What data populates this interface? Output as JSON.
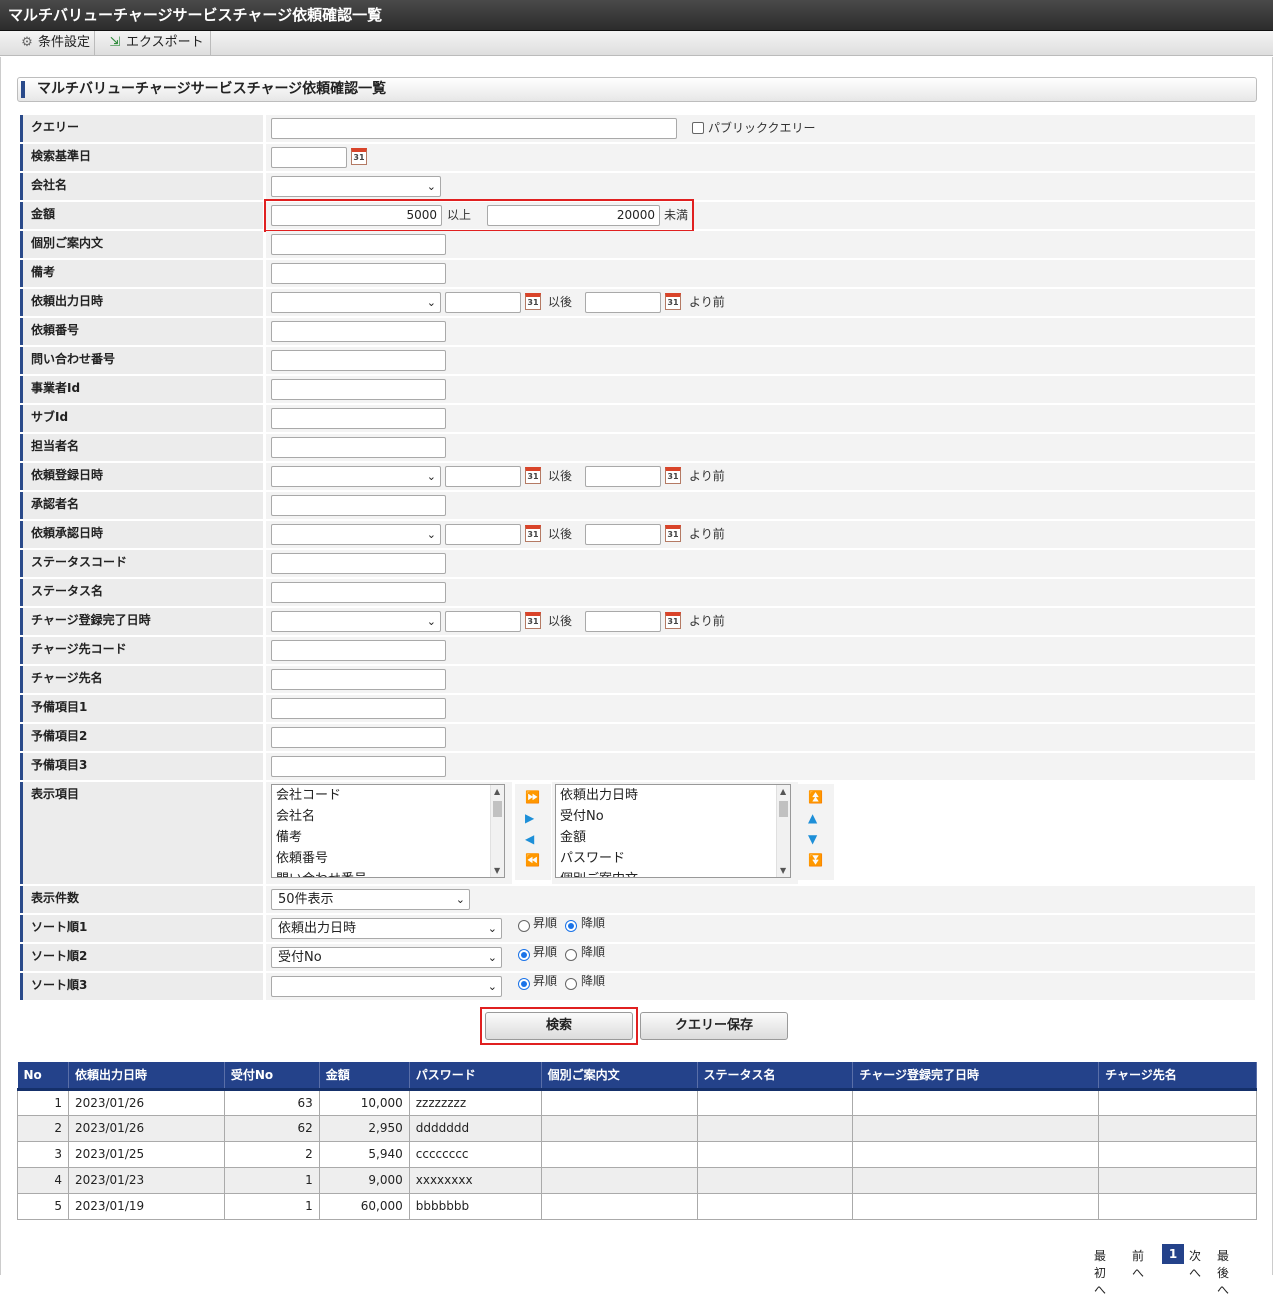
{
  "window": {
    "title": "マルチバリューチャージサービスチャージ依頼確認一覧"
  },
  "toolbar": {
    "conditions_label": "条件設定",
    "export_label": "エクスポート"
  },
  "section": {
    "title": "マルチバリューチャージサービスチャージ依頼確認一覧"
  },
  "form": {
    "query": {
      "label": "クエリー",
      "value": "",
      "public_label": "パブリッククエリー"
    },
    "base_date": {
      "label": "検索基準日",
      "value": ""
    },
    "company": {
      "label": "会社名",
      "value": ""
    },
    "amount": {
      "label": "金額",
      "min": "5000",
      "min_suffix": "以上",
      "max": "20000",
      "max_suffix": "未満"
    },
    "guide_text": {
      "label": "個別ご案内文",
      "value": ""
    },
    "remarks": {
      "label": "備考",
      "value": ""
    },
    "output_date": {
      "label": "依頼出力日時",
      "after": "以後",
      "before": "より前"
    },
    "request_no": {
      "label": "依頼番号",
      "value": ""
    },
    "inquiry_no": {
      "label": "問い合わせ番号",
      "value": ""
    },
    "business_id": {
      "label": "事業者Id",
      "value": ""
    },
    "sub_id": {
      "label": "サブId",
      "value": ""
    },
    "person": {
      "label": "担当者名",
      "value": ""
    },
    "register_date": {
      "label": "依頼登録日時",
      "after": "以後",
      "before": "より前"
    },
    "approver": {
      "label": "承認者名",
      "value": ""
    },
    "approve_date": {
      "label": "依頼承認日時",
      "after": "以後",
      "before": "より前"
    },
    "status_code": {
      "label": "ステータスコード",
      "value": ""
    },
    "status_name": {
      "label": "ステータス名",
      "value": ""
    },
    "charge_done_date": {
      "label": "チャージ登録完了日時",
      "after": "以後",
      "before": "より前"
    },
    "charge_code": {
      "label": "チャージ先コード",
      "value": ""
    },
    "charge_name": {
      "label": "チャージ先名",
      "value": ""
    },
    "spare1": {
      "label": "予備項目1",
      "value": ""
    },
    "spare2": {
      "label": "予備項目2",
      "value": ""
    },
    "spare3": {
      "label": "予備項目3",
      "value": ""
    },
    "display_items": {
      "label": "表示項目",
      "available": [
        "会社コード",
        "会社名",
        "備考",
        "依頼番号",
        "問い合わせ番号"
      ],
      "selected": [
        "依頼出力日時",
        "受付No",
        "金額",
        "パスワード",
        "個別ご案内文"
      ]
    },
    "page_size": {
      "label": "表示件数",
      "value": "50件表示"
    },
    "sort1": {
      "label": "ソート順1",
      "value": "依頼出力日時",
      "asc": "昇順",
      "desc": "降順",
      "selected": "desc"
    },
    "sort2": {
      "label": "ソート順2",
      "value": "受付No",
      "asc": "昇順",
      "desc": "降順",
      "selected": "asc"
    },
    "sort3": {
      "label": "ソート順3",
      "value": "",
      "asc": "昇順",
      "desc": "降順",
      "selected": "asc"
    }
  },
  "buttons": {
    "search": "検索",
    "save_query": "クエリー保存"
  },
  "results": {
    "columns": [
      "No",
      "依頼出力日時",
      "受付No",
      "金額",
      "パスワード",
      "個別ご案内文",
      "ステータス名",
      "チャージ登録完了日時",
      "チャージ先名"
    ],
    "rows": [
      [
        "1",
        "2023/01/26",
        "63",
        "10,000",
        "zzzzzzzz",
        "",
        "",
        "",
        ""
      ],
      [
        "2",
        "2023/01/26",
        "62",
        "2,950",
        "ddddddd",
        "",
        "",
        "",
        ""
      ],
      [
        "3",
        "2023/01/25",
        "2",
        "5,940",
        "cccccccc",
        "",
        "",
        "",
        ""
      ],
      [
        "4",
        "2023/01/23",
        "1",
        "9,000",
        "xxxxxxxx",
        "",
        "",
        "",
        ""
      ],
      [
        "5",
        "2023/01/19",
        "1",
        "60,000",
        "bbbbbbb",
        "",
        "",
        "",
        ""
      ]
    ]
  },
  "pager": {
    "first": "最初へ",
    "prev": "前へ",
    "current": "1",
    "next": "次へ",
    "last": "最後へ"
  },
  "colors": {
    "accent": "#24428a",
    "highlight": "#e02020"
  }
}
